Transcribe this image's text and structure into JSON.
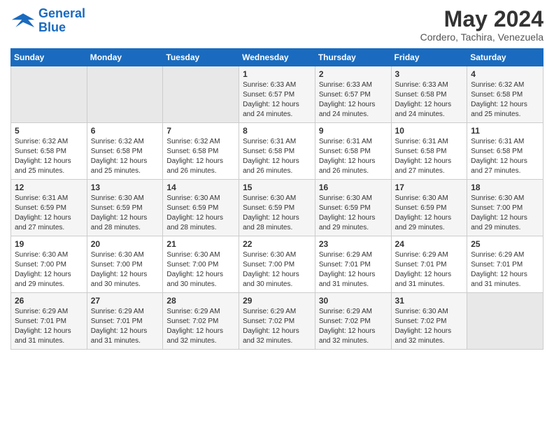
{
  "logo": {
    "line1": "General",
    "line2": "Blue"
  },
  "title": "May 2024",
  "subtitle": "Cordero, Tachira, Venezuela",
  "days_header": [
    "Sunday",
    "Monday",
    "Tuesday",
    "Wednesday",
    "Thursday",
    "Friday",
    "Saturday"
  ],
  "weeks": [
    [
      {
        "num": "",
        "info": ""
      },
      {
        "num": "",
        "info": ""
      },
      {
        "num": "",
        "info": ""
      },
      {
        "num": "1",
        "info": "Sunrise: 6:33 AM\nSunset: 6:57 PM\nDaylight: 12 hours\nand 24 minutes."
      },
      {
        "num": "2",
        "info": "Sunrise: 6:33 AM\nSunset: 6:57 PM\nDaylight: 12 hours\nand 24 minutes."
      },
      {
        "num": "3",
        "info": "Sunrise: 6:33 AM\nSunset: 6:58 PM\nDaylight: 12 hours\nand 24 minutes."
      },
      {
        "num": "4",
        "info": "Sunrise: 6:32 AM\nSunset: 6:58 PM\nDaylight: 12 hours\nand 25 minutes."
      }
    ],
    [
      {
        "num": "5",
        "info": "Sunrise: 6:32 AM\nSunset: 6:58 PM\nDaylight: 12 hours\nand 25 minutes."
      },
      {
        "num": "6",
        "info": "Sunrise: 6:32 AM\nSunset: 6:58 PM\nDaylight: 12 hours\nand 25 minutes."
      },
      {
        "num": "7",
        "info": "Sunrise: 6:32 AM\nSunset: 6:58 PM\nDaylight: 12 hours\nand 26 minutes."
      },
      {
        "num": "8",
        "info": "Sunrise: 6:31 AM\nSunset: 6:58 PM\nDaylight: 12 hours\nand 26 minutes."
      },
      {
        "num": "9",
        "info": "Sunrise: 6:31 AM\nSunset: 6:58 PM\nDaylight: 12 hours\nand 26 minutes."
      },
      {
        "num": "10",
        "info": "Sunrise: 6:31 AM\nSunset: 6:58 PM\nDaylight: 12 hours\nand 27 minutes."
      },
      {
        "num": "11",
        "info": "Sunrise: 6:31 AM\nSunset: 6:58 PM\nDaylight: 12 hours\nand 27 minutes."
      }
    ],
    [
      {
        "num": "12",
        "info": "Sunrise: 6:31 AM\nSunset: 6:59 PM\nDaylight: 12 hours\nand 27 minutes."
      },
      {
        "num": "13",
        "info": "Sunrise: 6:30 AM\nSunset: 6:59 PM\nDaylight: 12 hours\nand 28 minutes."
      },
      {
        "num": "14",
        "info": "Sunrise: 6:30 AM\nSunset: 6:59 PM\nDaylight: 12 hours\nand 28 minutes."
      },
      {
        "num": "15",
        "info": "Sunrise: 6:30 AM\nSunset: 6:59 PM\nDaylight: 12 hours\nand 28 minutes."
      },
      {
        "num": "16",
        "info": "Sunrise: 6:30 AM\nSunset: 6:59 PM\nDaylight: 12 hours\nand 29 minutes."
      },
      {
        "num": "17",
        "info": "Sunrise: 6:30 AM\nSunset: 6:59 PM\nDaylight: 12 hours\nand 29 minutes."
      },
      {
        "num": "18",
        "info": "Sunrise: 6:30 AM\nSunset: 7:00 PM\nDaylight: 12 hours\nand 29 minutes."
      }
    ],
    [
      {
        "num": "19",
        "info": "Sunrise: 6:30 AM\nSunset: 7:00 PM\nDaylight: 12 hours\nand 29 minutes."
      },
      {
        "num": "20",
        "info": "Sunrise: 6:30 AM\nSunset: 7:00 PM\nDaylight: 12 hours\nand 30 minutes."
      },
      {
        "num": "21",
        "info": "Sunrise: 6:30 AM\nSunset: 7:00 PM\nDaylight: 12 hours\nand 30 minutes."
      },
      {
        "num": "22",
        "info": "Sunrise: 6:30 AM\nSunset: 7:00 PM\nDaylight: 12 hours\nand 30 minutes."
      },
      {
        "num": "23",
        "info": "Sunrise: 6:29 AM\nSunset: 7:01 PM\nDaylight: 12 hours\nand 31 minutes."
      },
      {
        "num": "24",
        "info": "Sunrise: 6:29 AM\nSunset: 7:01 PM\nDaylight: 12 hours\nand 31 minutes."
      },
      {
        "num": "25",
        "info": "Sunrise: 6:29 AM\nSunset: 7:01 PM\nDaylight: 12 hours\nand 31 minutes."
      }
    ],
    [
      {
        "num": "26",
        "info": "Sunrise: 6:29 AM\nSunset: 7:01 PM\nDaylight: 12 hours\nand 31 minutes."
      },
      {
        "num": "27",
        "info": "Sunrise: 6:29 AM\nSunset: 7:01 PM\nDaylight: 12 hours\nand 31 minutes."
      },
      {
        "num": "28",
        "info": "Sunrise: 6:29 AM\nSunset: 7:02 PM\nDaylight: 12 hours\nand 32 minutes."
      },
      {
        "num": "29",
        "info": "Sunrise: 6:29 AM\nSunset: 7:02 PM\nDaylight: 12 hours\nand 32 minutes."
      },
      {
        "num": "30",
        "info": "Sunrise: 6:29 AM\nSunset: 7:02 PM\nDaylight: 12 hours\nand 32 minutes."
      },
      {
        "num": "31",
        "info": "Sunrise: 6:30 AM\nSunset: 7:02 PM\nDaylight: 12 hours\nand 32 minutes."
      },
      {
        "num": "",
        "info": ""
      }
    ]
  ]
}
